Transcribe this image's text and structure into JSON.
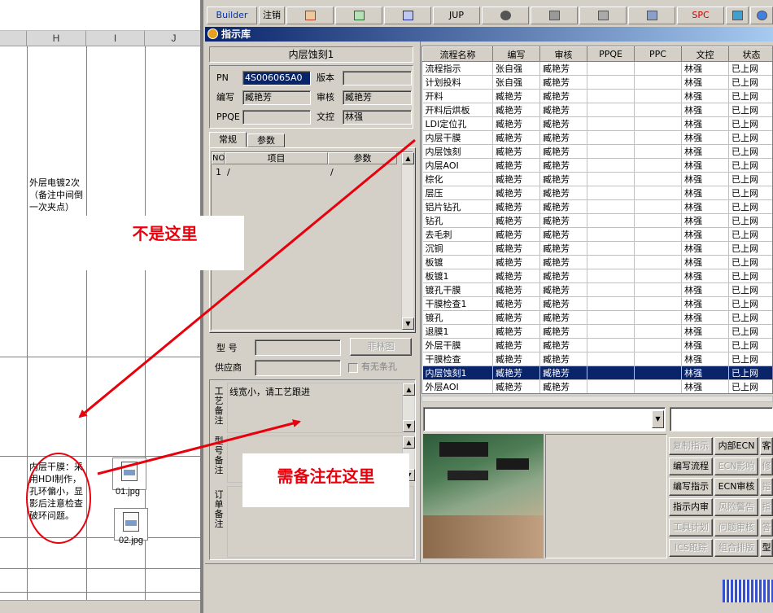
{
  "sheet": {
    "columns": [
      "H",
      "I",
      "J"
    ],
    "cell_upper": "外层电镀2次（备注中间倒一次夹点）",
    "cell_lower": "内层干膜：采用HDI制作，孔环偏小，显影后注意检查破环问题。",
    "attachments": [
      "01.jpg",
      "02.jpg"
    ]
  },
  "toolbar": {
    "builder": "Builder",
    "logout": "注销",
    "jup": "JUP",
    "spc": "SPC",
    "icons": [
      "html-icon",
      "excel-icon",
      "word-icon",
      "eye-icon",
      "database-icon",
      "network-icon",
      "computer-icon",
      "refresh-icon",
      "ie-icon"
    ]
  },
  "window": {
    "title": "指示库",
    "step_title": "内层蚀刻1",
    "pn_label": "PN",
    "pn_value": "4S006065A0",
    "version_label": "版本",
    "version_value": "",
    "writer_label": "编写",
    "writer_value": "臧艳芳",
    "reviewer_label": "审核",
    "reviewer_value": "臧艳芳",
    "ppqe_label": "PPQE",
    "ppqe_value": "",
    "doc_label": "文控",
    "doc_value": "林强",
    "tabs": [
      "常规",
      "参数"
    ],
    "param_headers": [
      "NO",
      "项目",
      "参数"
    ],
    "param_rows": [
      {
        "no": "1",
        "item": "/",
        "param": "/"
      }
    ],
    "model_label": "型 号",
    "supplier_label": "供应商",
    "film_button": "菲林图",
    "no_barcode_label": "有无条孔",
    "process_note_label": "工艺备注",
    "process_note_text": "线宽小，请工艺跟进",
    "model_note_label": "型号备注",
    "order_note_label": "订单备注"
  },
  "grid": {
    "headers": [
      "流程名称",
      "编写",
      "审核",
      "PPQE",
      "PPC",
      "文控",
      "状态"
    ],
    "selected_index": 22,
    "rows": [
      [
        "流程指示",
        "张自强",
        "臧艳芳",
        "",
        "",
        "林强",
        "已上网"
      ],
      [
        "计划投料",
        "张自强",
        "臧艳芳",
        "",
        "",
        "林强",
        "已上网"
      ],
      [
        "开料",
        "臧艳芳",
        "臧艳芳",
        "",
        "",
        "林强",
        "已上网"
      ],
      [
        "开料后烘板",
        "臧艳芳",
        "臧艳芳",
        "",
        "",
        "林强",
        "已上网"
      ],
      [
        "LDI定位孔",
        "臧艳芳",
        "臧艳芳",
        "",
        "",
        "林强",
        "已上网"
      ],
      [
        "内层干膜",
        "臧艳芳",
        "臧艳芳",
        "",
        "",
        "林强",
        "已上网"
      ],
      [
        "内层蚀刻",
        "臧艳芳",
        "臧艳芳",
        "",
        "",
        "林强",
        "已上网"
      ],
      [
        "内层AOI",
        "臧艳芳",
        "臧艳芳",
        "",
        "",
        "林强",
        "已上网"
      ],
      [
        "棕化",
        "臧艳芳",
        "臧艳芳",
        "",
        "",
        "林强",
        "已上网"
      ],
      [
        "层压",
        "臧艳芳",
        "臧艳芳",
        "",
        "",
        "林强",
        "已上网"
      ],
      [
        "铝片钻孔",
        "臧艳芳",
        "臧艳芳",
        "",
        "",
        "林强",
        "已上网"
      ],
      [
        "钻孔",
        "臧艳芳",
        "臧艳芳",
        "",
        "",
        "林强",
        "已上网"
      ],
      [
        "去毛刺",
        "臧艳芳",
        "臧艳芳",
        "",
        "",
        "林强",
        "已上网"
      ],
      [
        "沉铜",
        "臧艳芳",
        "臧艳芳",
        "",
        "",
        "林强",
        "已上网"
      ],
      [
        "板镀",
        "臧艳芳",
        "臧艳芳",
        "",
        "",
        "林强",
        "已上网"
      ],
      [
        "板镀1",
        "臧艳芳",
        "臧艳芳",
        "",
        "",
        "林强",
        "已上网"
      ],
      [
        "镀孔干膜",
        "臧艳芳",
        "臧艳芳",
        "",
        "",
        "林强",
        "已上网"
      ],
      [
        "干膜检查1",
        "臧艳芳",
        "臧艳芳",
        "",
        "",
        "林强",
        "已上网"
      ],
      [
        "镀孔",
        "臧艳芳",
        "臧艳芳",
        "",
        "",
        "林强",
        "已上网"
      ],
      [
        "退膜1",
        "臧艳芳",
        "臧艳芳",
        "",
        "",
        "林强",
        "已上网"
      ],
      [
        "外层干膜",
        "臧艳芳",
        "臧艳芳",
        "",
        "",
        "林强",
        "已上网"
      ],
      [
        "干膜检查",
        "臧艳芳",
        "臧艳芳",
        "",
        "",
        "林强",
        "已上网"
      ],
      [
        "内层蚀刻1",
        "臧艳芳",
        "臧艳芳",
        "",
        "",
        "林强",
        "已上网"
      ],
      [
        "外层AOI",
        "臧艳芳",
        "臧艳芳",
        "",
        "",
        "林强",
        "已上网"
      ]
    ]
  },
  "actions": {
    "col1": [
      "复制指示",
      "编写流程",
      "编写指示",
      "指示内审",
      "工具计划",
      "ICS跟踪"
    ],
    "col2": [
      "内部ECN",
      "ECN影响",
      "ECN审核",
      "风险警告",
      "问题审核",
      "组合排版"
    ],
    "col3": [
      "客",
      "修",
      "指",
      "指",
      "答",
      "型"
    ],
    "disabled": [
      "复制指示",
      "ECN影响",
      "修",
      "风险警告",
      "指",
      "工具计划",
      "问题审核",
      "答",
      "ICS跟踪",
      "组合排版"
    ]
  },
  "annotations": {
    "not_here": "不是这里",
    "note_here": "需备注在这里"
  },
  "colors": {
    "title_start": "#0a246a",
    "title_end": "#a6caf0",
    "selection": "#0a246a",
    "annotation": "#e8000c"
  }
}
